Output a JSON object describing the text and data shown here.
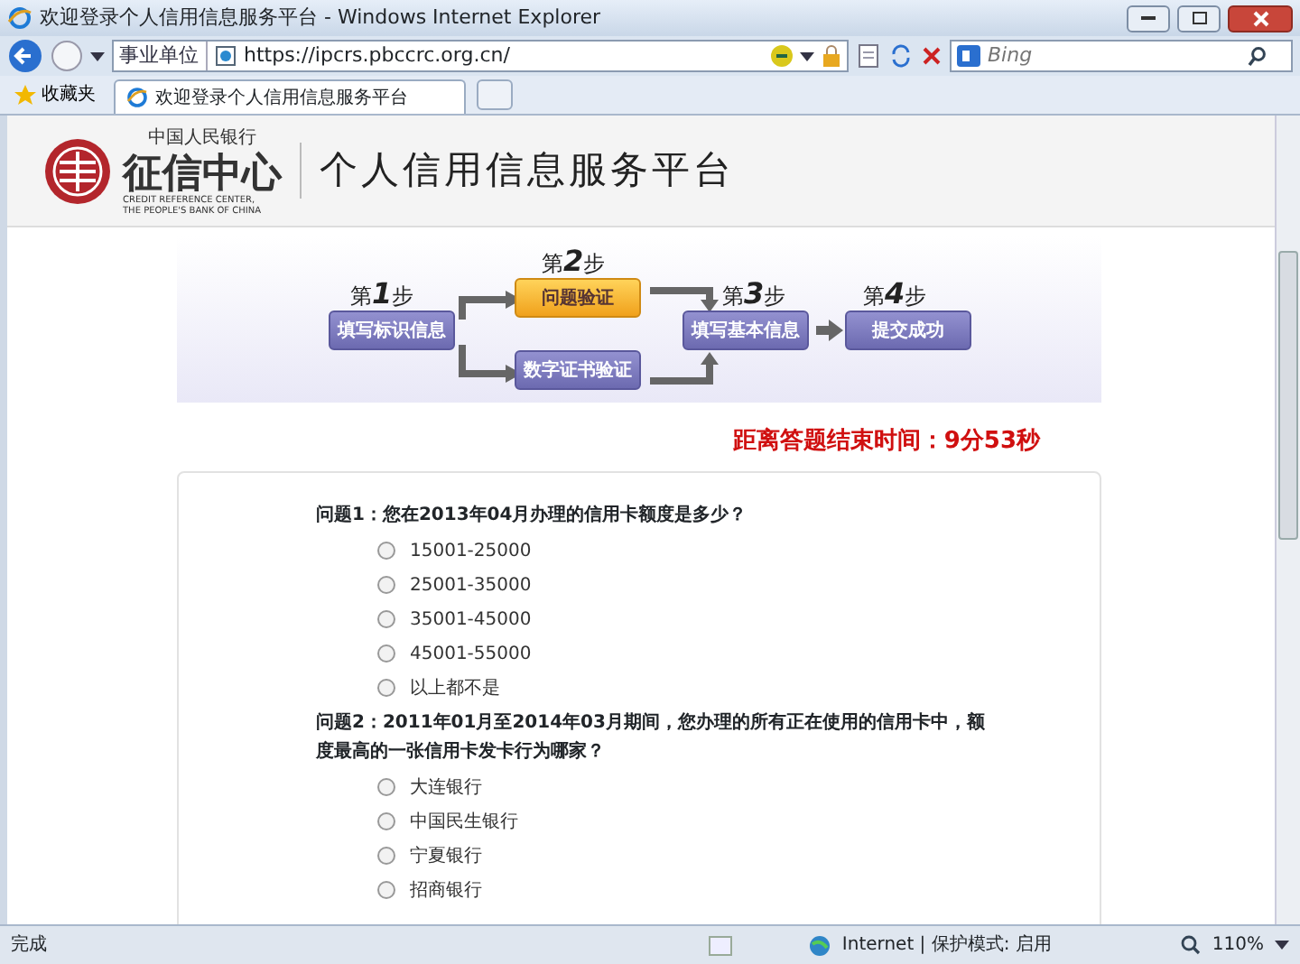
{
  "window": {
    "title": "欢迎登录个人信用信息服务平台 - Windows Internet Explorer"
  },
  "address_bar": {
    "zone": "事业单位",
    "url": "https://ipcrs.pbccrc.org.cn/"
  },
  "search": {
    "placeholder": "Bing"
  },
  "favorites_bar": {
    "favorites": "收藏夹",
    "tabs": [
      {
        "label": "欢迎登录个人信用信息服务平台",
        "selected": true
      }
    ]
  },
  "header": {
    "bank_name": "中国人民银行",
    "logo_text": "征信中心",
    "english": [
      "CREDIT REFERENCE CENTER,",
      "THE PEOPLE'S BANK OF CHINA"
    ],
    "platform_title": "个人信用信息服务平台"
  },
  "steps": [
    {
      "heading": "第**1**步",
      "boxes": [
        {
          "label": "填写标识信息",
          "selected": false
        }
      ]
    },
    {
      "heading": "第**2**步",
      "boxes": [
        {
          "label": "问题验证",
          "selected": true
        },
        {
          "label": "数字证书验证",
          "selected": false
        }
      ]
    },
    {
      "heading": "第**3**步",
      "boxes": [
        {
          "label": "填写基本信息",
          "selected": false
        }
      ]
    },
    {
      "heading": "第**4**步",
      "boxes": [
        {
          "label": "提交成功",
          "selected": false
        }
      ]
    }
  ],
  "timer": "距离答题结束时间：9分53秒",
  "questions": [
    {
      "text": "问题1：您在2013年04月办理的信用卡额度是多少？",
      "options": [
        {
          "label": "15001-25000",
          "selected": false
        },
        {
          "label": "25001-35000",
          "selected": false
        },
        {
          "label": "35001-45000",
          "selected": false
        },
        {
          "label": "45001-55000",
          "selected": false
        },
        {
          "label": "以上都不是",
          "selected": false
        }
      ]
    },
    {
      "text": "问题2：2011年01月至2014年03月期间，您办理的所有正在使用的信用卡中，额度最高的一张信用卡发卡行为哪家？",
      "options": [
        {
          "label": "大连银行",
          "selected": false
        },
        {
          "label": "中国民生银行",
          "selected": false
        },
        {
          "label": "宁夏银行",
          "selected": false
        },
        {
          "label": "招商银行",
          "selected": false
        }
      ]
    }
  ],
  "status_bar": {
    "status": "完成",
    "zone": "Internet | 保护模式: 启用",
    "zoom": "110%"
  }
}
